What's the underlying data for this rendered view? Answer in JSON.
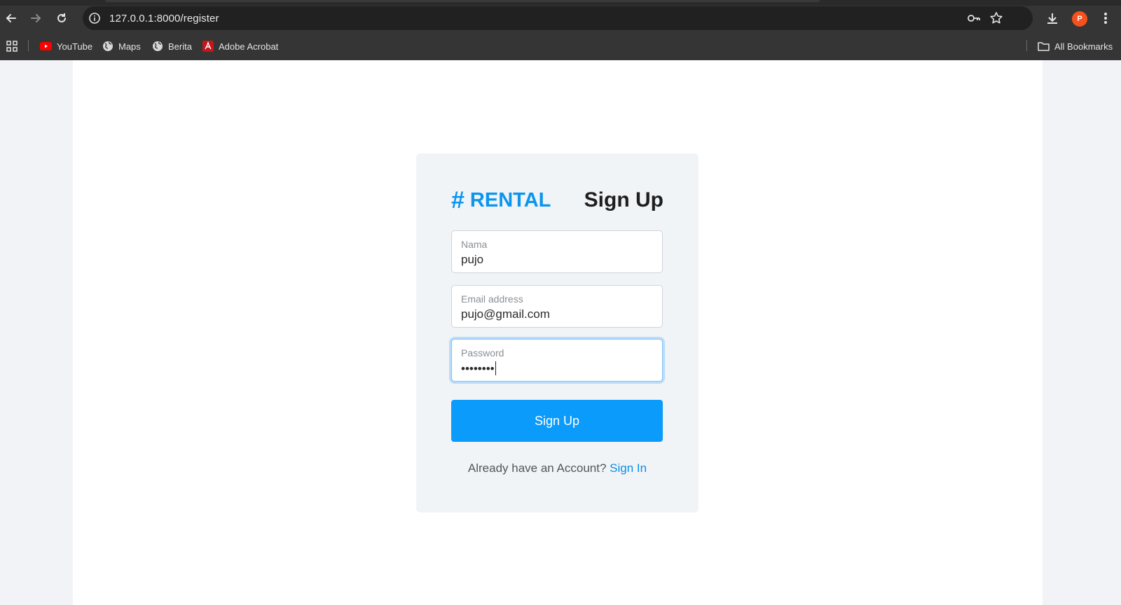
{
  "browser": {
    "url": "127.0.0.1:8000/register",
    "profile_initial": "P",
    "bookmarks": [
      {
        "label": "YouTube",
        "icon": "youtube-icon"
      },
      {
        "label": "Maps",
        "icon": "globe-icon"
      },
      {
        "label": "Berita",
        "icon": "globe-icon"
      },
      {
        "label": "Adobe Acrobat",
        "icon": "acrobat-icon"
      }
    ],
    "all_bookmarks_label": "All Bookmarks"
  },
  "card": {
    "brand_hash": "#",
    "brand": "RENTAL",
    "title": "Sign Up",
    "fields": {
      "name": {
        "label": "Nama",
        "value": "pujo"
      },
      "email": {
        "label": "Email address",
        "value": "pujo@gmail.com"
      },
      "password": {
        "label": "Password",
        "value": "••••••••"
      }
    },
    "submit_label": "Sign Up",
    "footer_text": "Already have an Account?",
    "footer_link": "Sign In"
  },
  "colors": {
    "accent": "#0a9bfb",
    "brand": "#0b95ee",
    "chrome": "#353535"
  }
}
